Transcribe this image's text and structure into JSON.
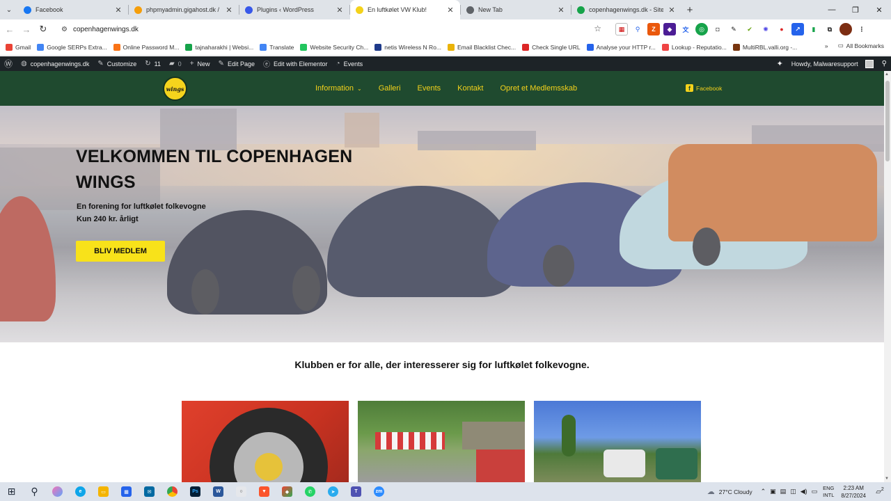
{
  "browser": {
    "tabs": [
      {
        "title": "Facebook",
        "color": "#1877f2",
        "active": false
      },
      {
        "title": "phpmyadmin.gigahost.dk / my:",
        "color": "#f59e0b",
        "active": false
      },
      {
        "title": "Plugins ‹ WordPress",
        "color": "#3858e9",
        "active": false
      },
      {
        "title": "En luftkølet VW Klub!",
        "color": "#f4d21b",
        "active": true
      },
      {
        "title": "New Tab",
        "color": "#5f6368",
        "active": false
      },
      {
        "title": "copenhagenwings.dk - SiteChe",
        "color": "#16a34a",
        "active": false
      }
    ],
    "new_tab": "+",
    "url": "copenhagenwings.dk",
    "bookmarks": [
      {
        "label": "Gmail",
        "color": "#ea4335"
      },
      {
        "label": "Google SERPs Extra...",
        "color": "#4285f4"
      },
      {
        "label": "Online Password M...",
        "color": "#f97316"
      },
      {
        "label": "tajnaharakhi | Websi...",
        "color": "#16a34a"
      },
      {
        "label": "Translate",
        "color": "#4285f4"
      },
      {
        "label": "Website Security Ch...",
        "color": "#22c55e"
      },
      {
        "label": "netis Wireless N Ro...",
        "color": "#1e3a8a"
      },
      {
        "label": "Email Blacklist Chec...",
        "color": "#eab308"
      },
      {
        "label": "Check Single URL",
        "color": "#dc2626"
      },
      {
        "label": "Analyse your HTTP r...",
        "color": "#2563eb"
      },
      {
        "label": "Lookup - Reputatio...",
        "color": "#ef4444"
      },
      {
        "label": "MultiRBL.valli.org -...",
        "color": "#78350f"
      }
    ],
    "all_bookmarks": "All Bookmarks"
  },
  "wp_admin": {
    "site": "copenhagenwings.dk",
    "customize": "Customize",
    "updates": "11",
    "comments": "0",
    "new": "New",
    "edit_page": "Edit Page",
    "edit_elementor": "Edit with Elementor",
    "events": "Events",
    "howdy": "Howdy, Malwaresupport"
  },
  "site": {
    "logo_text": "wings",
    "menu": [
      {
        "label": "Information",
        "dropdown": true
      },
      {
        "label": "Galleri",
        "dropdown": false
      },
      {
        "label": "Events",
        "dropdown": false
      },
      {
        "label": "Kontakt",
        "dropdown": false
      },
      {
        "label": "Opret et Medlemsskab",
        "dropdown": false
      }
    ],
    "facebook": "Facebook",
    "hero": {
      "title": "VELKOMMEN TIL COPENHAGEN WINGS",
      "subtitle_1": "En forening for luftkølet folkevogne",
      "subtitle_2": "Kun 240 kr. årligt",
      "cta": "BLIV MEDLEM"
    },
    "intro": "Klubben er for alle, der interesserer sig for luftkølet folkevogne."
  },
  "taskbar": {
    "weather": "27°C  Cloudy",
    "lang_1": "ENG",
    "lang_2": "INTL",
    "time": "2:23 AM",
    "date": "8/27/2024",
    "notifications": "2"
  },
  "colors": {
    "header_green": "#1f4a2f",
    "accent_yellow": "#f4d21b",
    "cta_yellow": "#f8e21a",
    "wp_bar": "#1d2327"
  }
}
